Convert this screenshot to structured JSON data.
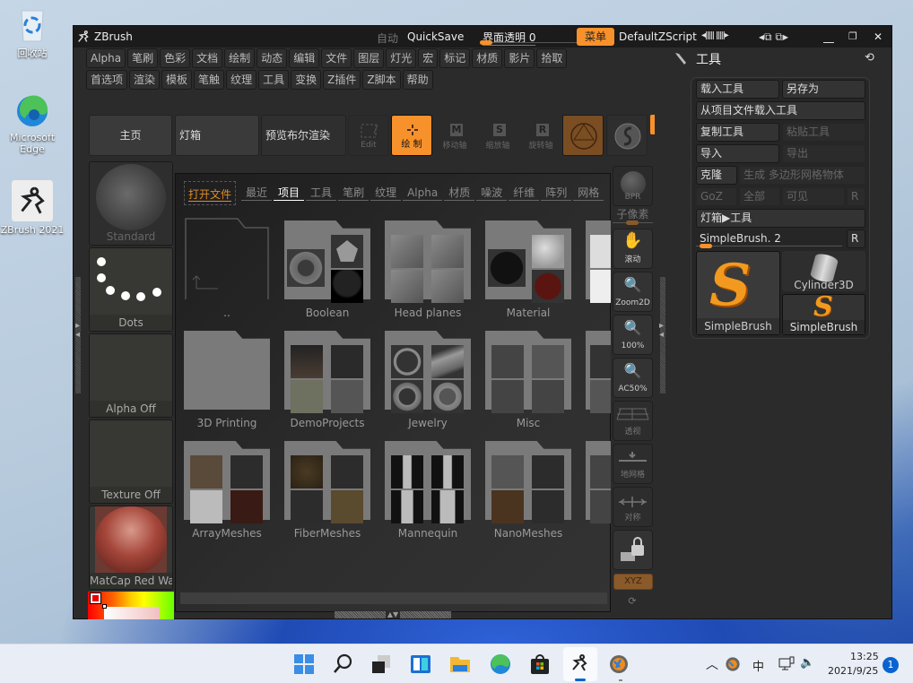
{
  "desktop": {
    "icons": [
      {
        "label": "回收站",
        "icon": "recycle-bin-icon"
      },
      {
        "label": "Microsoft Edge",
        "icon": "edge-icon"
      },
      {
        "label": "ZBrush 2021",
        "icon": "zbrush-icon"
      }
    ]
  },
  "window": {
    "title": "ZBrush",
    "auto_label": "自动",
    "quicksave": "QuickSave",
    "transparency": "界面透明 0",
    "transparency_value": 0,
    "menu_button": "菜单",
    "script": "DefaultZScript",
    "accent": "#f7912c",
    "menus_row1": [
      "Alpha",
      "笔刷",
      "色彩",
      "文档",
      "绘制",
      "动态",
      "编辑",
      "文件",
      "图层",
      "灯光",
      "宏",
      "标记",
      "材质",
      "影片",
      "拾取"
    ],
    "menus_row2": [
      "首选项",
      "渲染",
      "模板",
      "笔触",
      "纹理",
      "工具",
      "变换",
      "Z插件",
      "Z脚本",
      "帮助"
    ]
  },
  "toolbar": {
    "home": "主页",
    "lightbox": "灯箱",
    "bpr_preview": "预览布尔渲染",
    "edit": "Edit",
    "draw": "绘 制",
    "move": "移动轴",
    "scale": "缩放轴",
    "rotate": "旋转轴",
    "move_letter": "M",
    "scale_letter": "S",
    "rotate_letter": "R"
  },
  "left_shelf": {
    "brush": "Standard",
    "stroke": "Dots",
    "alpha": "Alpha Off",
    "texture": "Texture Off",
    "material": "MatCap Red Wax"
  },
  "lightbox": {
    "open_file": "打开文件",
    "tabs": [
      "最近",
      "项目",
      "工具",
      "笔刷",
      "纹理",
      "Alpha",
      "材质",
      "噪波",
      "纤维",
      "阵列",
      "网格"
    ],
    "active_tab": "项目",
    "folders_row1": [
      "..",
      "Boolean",
      "Head planes",
      "Material"
    ],
    "folders_row2": [
      "3D Printing",
      "DemoProjects",
      "Jewelry",
      "Misc"
    ],
    "folders_row3": [
      "ArrayMeshes",
      "FiberMeshes",
      "Mannequin",
      "NanoMeshes"
    ]
  },
  "right_shelf": {
    "bpr": "BPR",
    "subpixel": "子像素",
    "scroll": "滚动",
    "zoom2d": "Zoom2D",
    "actual": "100%",
    "ac50": "AC50%",
    "persp": "透视",
    "floor": "地网格",
    "sym": "对称",
    "xyz": "XYZ"
  },
  "tool_panel": {
    "title": "工具",
    "load_tool": "载入工具",
    "save_as": "另存为",
    "load_from_project": "从项目文件载入工具",
    "copy_tool": "复制工具",
    "paste_tool": "粘贴工具",
    "import": "导入",
    "export": "导出",
    "clone": "克隆",
    "make_polymesh": "生成 多边形网格物体",
    "goz": "GoZ",
    "all": "全部",
    "visible": "可见",
    "r": "R",
    "lightbox_tools": "灯箱▶工具",
    "current_tool": "SimpleBrush. 2",
    "thumbs": [
      "SimpleBrush",
      "Cylinder3D",
      "SimpleBrush"
    ]
  },
  "taskbar": {
    "time": "13:25",
    "date": "2021/9/25",
    "ime": "中",
    "notification_count": "1"
  }
}
